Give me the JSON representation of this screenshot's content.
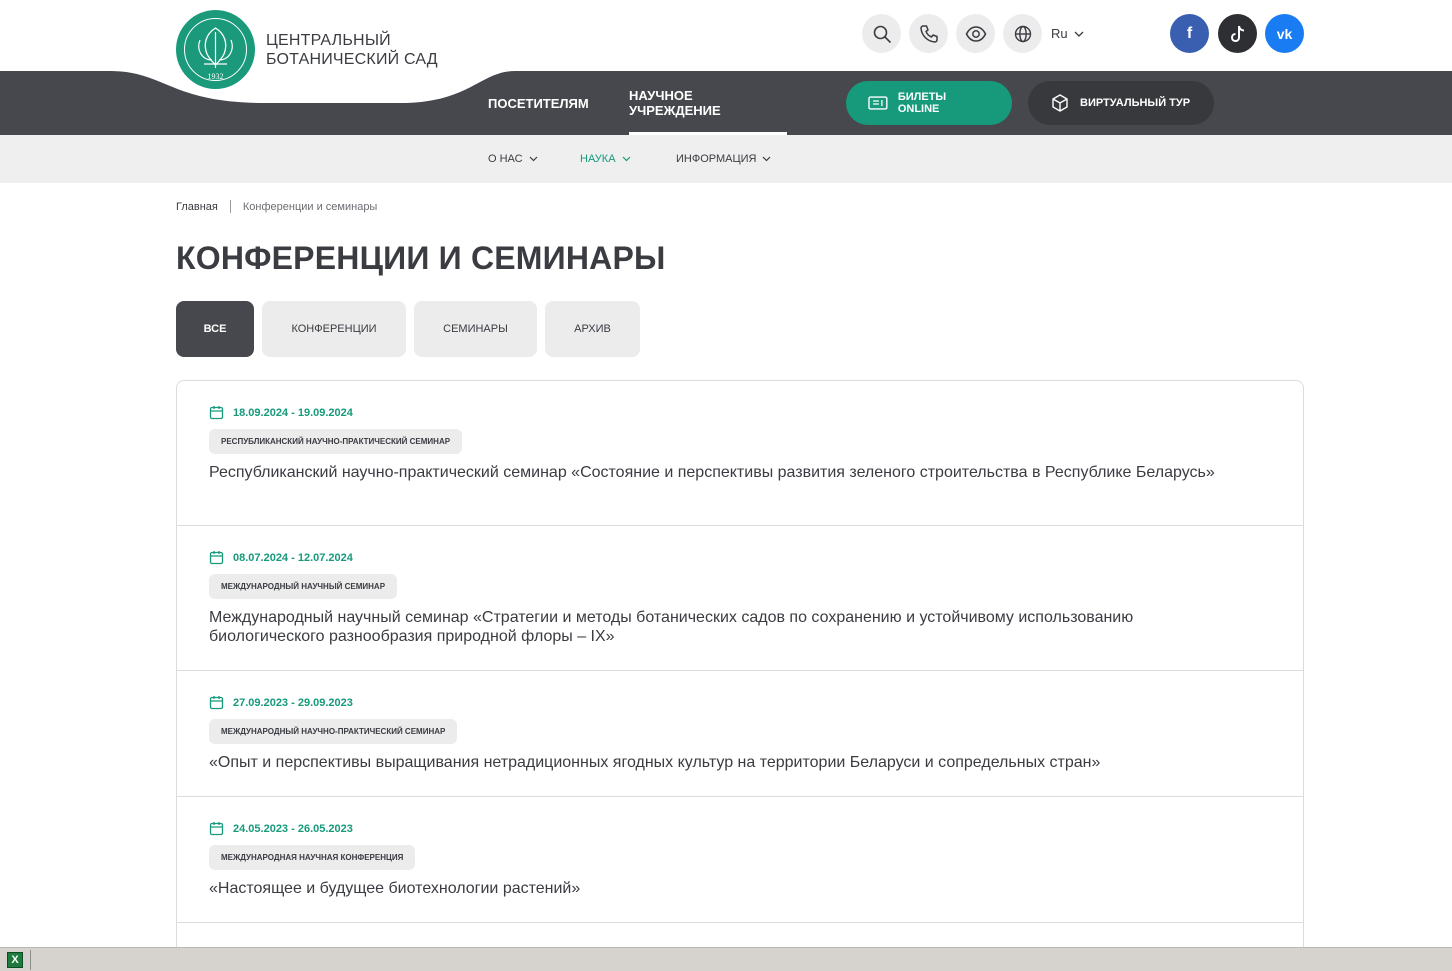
{
  "header": {
    "brand_line1": "ЦЕНТРАЛЬНЫЙ",
    "brand_line2": "БОТАНИЧЕСКИЙ САД",
    "logo_text": "ЦЕНТРАЛЬНЫ БАТАНІЧНЫ САД",
    "logo_year": "1932",
    "language": "Ru",
    "tools": [
      "search-icon",
      "phone-icon",
      "eye-icon",
      "globe-icon"
    ],
    "social": [
      {
        "name": "facebook",
        "glyph": "f",
        "color": "#3b5fb0"
      },
      {
        "name": "tiktok",
        "glyph": "♪",
        "color": "#2e2f33"
      },
      {
        "name": "vk",
        "glyph": "vk",
        "color": "#1a7cf2"
      }
    ]
  },
  "main_nav": {
    "visitors": "ПОСЕТИТЕЛЯМ",
    "science_institution": "НАУЧНОЕ УЧРЕЖДЕНИЕ",
    "tickets": "БИЛЕТЫ ONLINE",
    "virtual_tour": "ВИРТУАЛЬНЫЙ ТУР"
  },
  "sub_nav": {
    "about": "О НАС",
    "science": "НАУКА",
    "information": "ИНФОРМАЦИЯ"
  },
  "colors": {
    "accent": "#169a7b",
    "dark": "#47484d",
    "light": "#efefef"
  },
  "breadcrumb": {
    "home": "Главная",
    "current": "Конференции и семинары"
  },
  "page_title": "КОНФЕРЕНЦИИ И СЕМИНАРЫ",
  "filters": {
    "all": "ВСЕ",
    "conferences": "КОНФЕРЕНЦИИ",
    "seminars": "СЕМИНАРЫ",
    "archive": "АРХИВ",
    "selected": "ВСЕ"
  },
  "events": [
    {
      "dates": "18.09.2024 - 19.09.2024",
      "type": "РЕСПУБЛИКАНСКИЙ НАУЧНО-ПРАКТИЧЕСКИЙ СЕМИНАР",
      "title": "Республиканский научно-практический семинар «Состояние и перспективы развития зеленого строительства в Республике Беларусь»"
    },
    {
      "dates": "08.07.2024 - 12.07.2024",
      "type": "МЕЖДУНАРОДНЫЙ НАУЧНЫЙ СЕМИНАР",
      "title": "Международный научный семинар «Стратегии и методы ботанических садов по сохранению и устойчивому использованию биологического разнообразия природной флоры – IX»"
    },
    {
      "dates": "27.09.2023 - 29.09.2023",
      "type": "МЕЖДУНАРОДНЫЙ НАУЧНО-ПРАКТИЧЕСКИЙ СЕМИНАР",
      "title": "«Опыт и перспективы выращивания нетрадиционных ягодных культур на территории Беларуси и сопредельных стран»"
    },
    {
      "dates": "24.05.2023 - 26.05.2023",
      "type": "МЕЖДУНАРОДНАЯ НАУЧНАЯ КОНФЕРЕНЦИЯ",
      "title": "«Настоящее и будущее биотехнологии растений»"
    }
  ],
  "taskbar": {
    "app_icon": "excel-icon",
    "app_glyph": "X"
  }
}
